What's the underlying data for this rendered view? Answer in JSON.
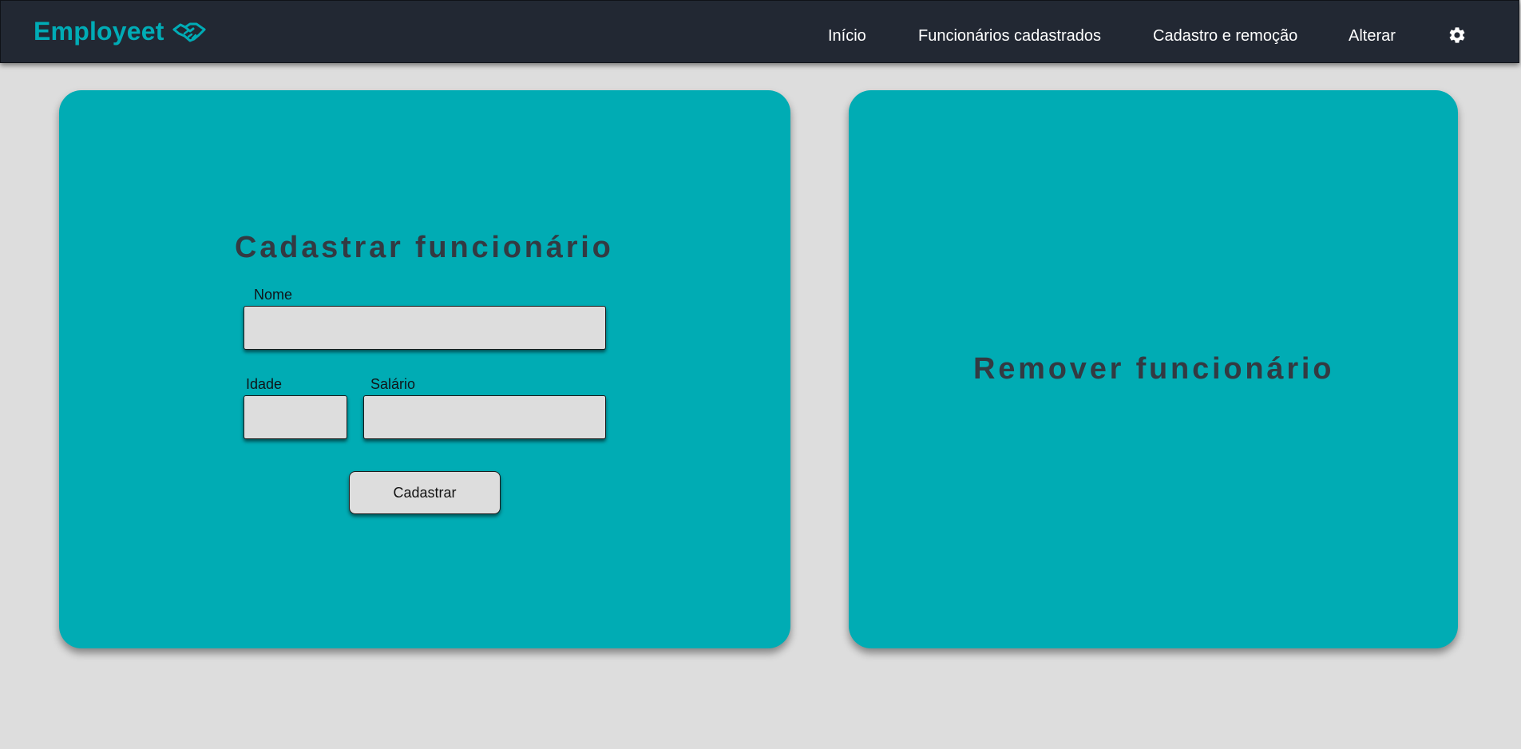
{
  "app": {
    "brand": "Employeet",
    "brand_icon": "handshake-icon",
    "brand_color": "#00acb6"
  },
  "nav": {
    "items": [
      {
        "label": "Início"
      },
      {
        "label": "Funcionários cadastrados"
      },
      {
        "label": "Cadastro e remoção"
      },
      {
        "label": "Alterar"
      }
    ],
    "settings_icon": "gear-icon",
    "background": "#222833"
  },
  "register_card": {
    "title": "Cadastrar funcionário",
    "fields": {
      "name_label": "Nome",
      "name_value": "",
      "age_label": "Idade",
      "age_value": "",
      "salary_label": "Salário",
      "salary_value": ""
    },
    "submit_label": "Cadastrar",
    "background": "#00acb4"
  },
  "remove_card": {
    "title": "Remover funcionário",
    "background": "#00acb4"
  }
}
